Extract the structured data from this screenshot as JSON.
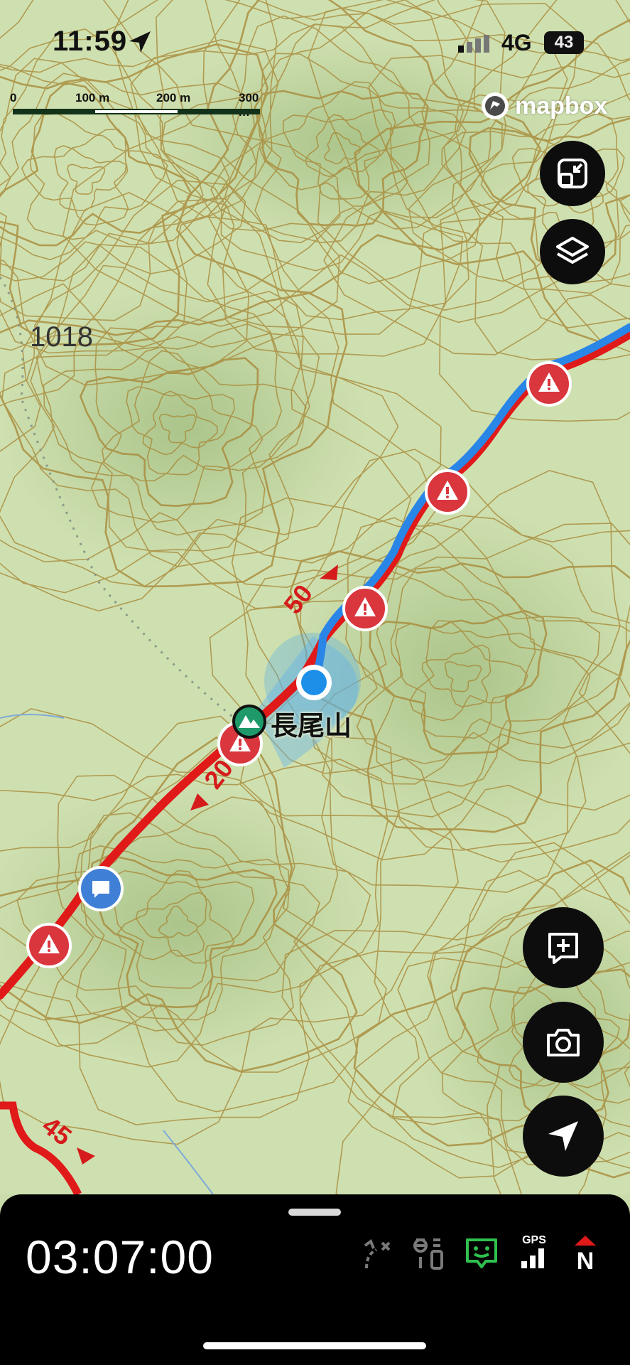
{
  "status_bar": {
    "time": "11:59",
    "network": "4G",
    "battery": "43"
  },
  "scale_bar": {
    "labels": [
      "0",
      "100 m",
      "200 m",
      "300 m"
    ]
  },
  "map": {
    "attribution": "mapbox",
    "elevation_label": "1018",
    "peak_name": "長尾山",
    "distance_markers": [
      "50",
      "20",
      "45"
    ],
    "route_colors": {
      "planned": "#e01919",
      "recorded": "#2a86e6"
    }
  },
  "controls": {
    "top_buttons": [
      "expand-icon",
      "layers-icon"
    ],
    "bottom_buttons": [
      "add-comment-icon",
      "camera-icon",
      "navigation-arrow-icon"
    ]
  },
  "panel": {
    "elapsed_time": "03:07:00",
    "gps_label": "GPS",
    "compass_label": "N"
  }
}
